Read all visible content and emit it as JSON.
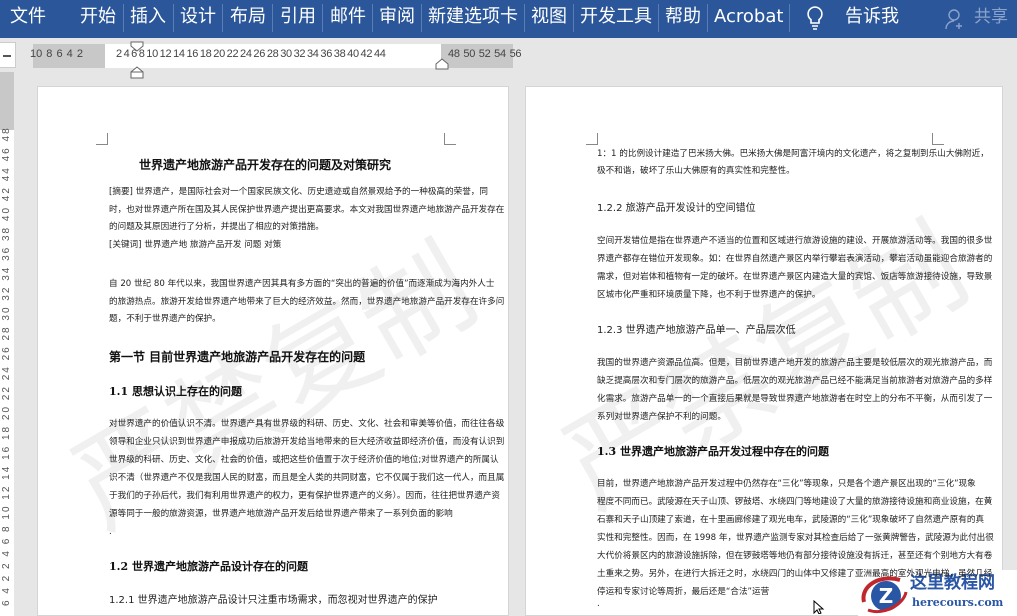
{
  "ribbon": {
    "tabs": [
      "文件",
      "开始",
      "插入",
      "设计",
      "布局",
      "引用",
      "邮件",
      "审阅",
      "新建选项卡",
      "视图",
      "开发工具",
      "帮助",
      "Acrobat"
    ],
    "tell_me": "告诉我",
    "share": "共享"
  },
  "ruler": {
    "left_margin_nums": "10 8  6  4  2",
    "body_nums": "2  4  6  8  10 12 14 16 18 20 22 24 26 28 30 32 34 36 38 40 42 44",
    "right_margin_nums": "48 50 52 54 56",
    "vertical_nums": "6 4 2  2 4 6 8 10 12 14 16 18 20 22 24 26 28 30 32 34 36 38 40 42 44 46 48"
  },
  "watermark": "严禁复制",
  "left_page": {
    "title": [
      "世界遗产地旅游产品开发存在的问题及对策研究"
    ],
    "abstract": [
      "[摘要] 世界遗产，是国际社会对一个国家民族文化、历史遗迹或自然景观给予的一种极高的荣誉，同",
      "时，也对世界遗产所在国及其人民保护世界遗产提出更高要求。本文对我国世界遗产地旅游产品开发存在",
      "的问题及其原因进行了分析，并提出了相应的对策措施。",
      "[关键词] 世界遗产地    旅游产品开发    问题    对策"
    ],
    "intro": [
      "自 20 世纪 80 年代以来，我国世界遗产因其具有多方面的“突出的普遍的价值”而逐渐成为海内外人士",
      "的旅游热点。旅游开发给世界遗产地带来了巨大的经济效益。然而，世界遗产地旅游产品开发存在许多问",
      "题，不利于世界遗产的保护。"
    ],
    "section1": [
      "第一节      目前世界遗产地旅游产品开发存在的问题"
    ],
    "h11": [
      "1.1  思想认识上存在的问题"
    ],
    "p11": [
      "对世界遗产的价值认识不清。世界遗产具有世界级的科研、历史、文化、社会和审美等价值，而往往各级",
      "领导和企业只认识到世界遗产申报成功后旅游开发给当地带来的巨大经济收益即经济价值，而没有认识到",
      "世界级的科研、历史、文化、社会的价值，或把这些价值置于次于经济价值的地位;对世界遗产的所属认",
      "识不清（世界遗产不仅是我国人民的财富，而且是全人类的共同财富，它不仅属于我们这一代人，而且属",
      "于我们的子孙后代，我们有利用世界遗产的权力，更有保护世界遗产的义务）。因而，往往把世界遗产资",
      "源等同于一般的旅游资源，世界遗产地旅游产品开发后给世界遗产带来了一系列负面的影响"
    ],
    "dot": [
      "."
    ],
    "h12": [
      "1.2  世界遗产地旅游产品设计存在的问题"
    ],
    "h121": [
      "1.2.1      世界遗产地旅游产品设计只注重市场需求，而忽视对世界遗产的保护"
    ]
  },
  "right_page": {
    "p0": [
      "1：1 的比例设计建造了巴米扬大佛。巴米扬大佛是阿富汗境内的文化遗产，将之复制到乐山大佛附近，",
      "极不和谐，破坏了乐山大佛原有的真实性和完整性。"
    ],
    "h122": [
      "1.2.2      旅游产品开发设计的空间错位"
    ],
    "p122": [
      "空间开发错位是指在世界遗产不适当的位置和区域进行旅游设施的建设、开展旅游活动等。我国的很多世",
      "界遗产都存在错位开发现象。如：在世界自然遗产景区内举行攀岩表演活动，攀岩活动虽能迎合旅游者的",
      "需求，但对岩体和植物有一定的破坏。在世界遗产景区内建造大量的宾馆、饭店等旅游接待设施，导致景",
      "区城市化严重和环境质量下降，也不利于世界遗产的保护。"
    ],
    "h123": [
      "1.2.3      世界遗产地旅游产品单一、产品层次低"
    ],
    "p123": [
      "我国的世界遗产资源品位高。但是，目前世界遗产地开发的旅游产品主要是较低层次的观光旅游产品，而",
      "缺乏提高层次和专门层次的旅游产品。低层次的观光旅游产品已经不能满足当前旅游者对旅游产品的多样",
      "化需求。旅游产品单一的一个直接后果就是导致世界遗产地旅游者在时空上的分布不平衡，从而引发了一",
      "系列对世界遗产保护不利的问题。"
    ],
    "h13": [
      "1.3  世界遗产地旅游产品开发过程中存在的问题"
    ],
    "p13": [
      "目前，世界遗产地旅游产品开发过程中仍然存在“三化”等现象，只是各个遗产景区出现的“三化”现象",
      "程度不同而已。武陵源在天子山顶、锣鼓塔、水绕四门等地建设了大量的旅游接待设施和商业设施，在黄",
      "石寨和天子山顶建了索道，在十里画廊修建了观光电车，武陵源的“三化”现象破坏了自然遗产原有的真",
      "实性和完整性。因而，在 1998 年，世界遗产监测专家对其检查后给了一张黄牌警告，武陵源为此付出很",
      "大代价将景区内的旅游设施拆除，但在锣鼓塔等地仍有部分接待设施没有拆迁，甚至还有个别地方大有卷",
      "土重来之势。另外，在进行大拆迁之时，水绕四门的山体中又修建了亚洲最高的室外观光电梯，虽然几经",
      "停运和专家讨论等周折，最后还是“合法”运营"
    ],
    "dot": [
      "."
    ]
  },
  "logo": {
    "name": "这里教程网",
    "url": "herecours.com",
    "letter": "Z"
  }
}
